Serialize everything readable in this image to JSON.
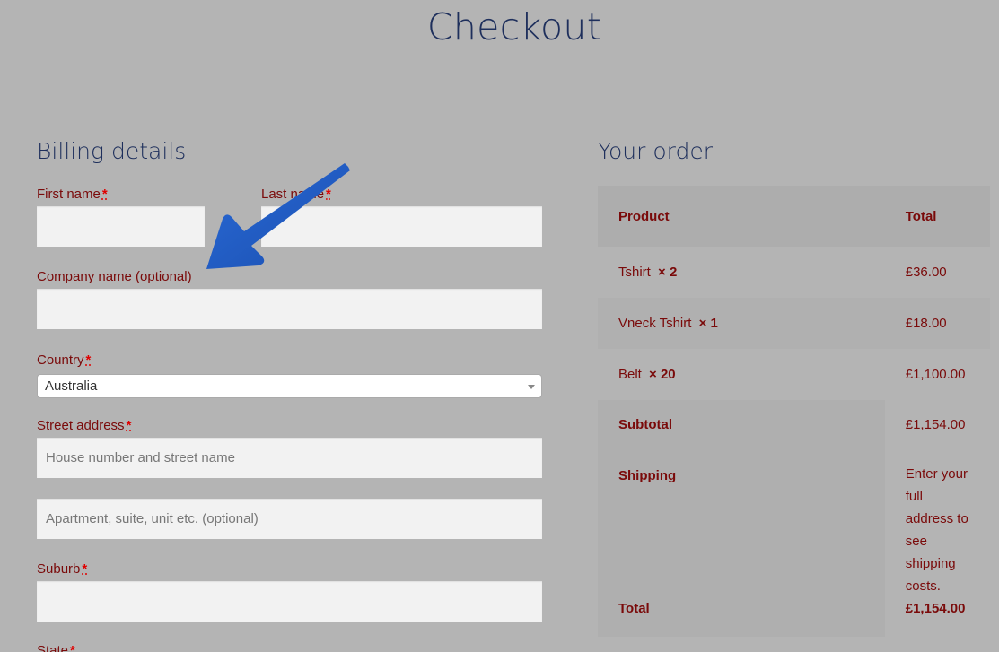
{
  "page": {
    "title": "Checkout"
  },
  "billing": {
    "title": "Billing details",
    "required_marker": "*",
    "fields": {
      "first_name": {
        "label": "First name",
        "value": ""
      },
      "last_name": {
        "label": "Last name",
        "value": ""
      },
      "company": {
        "label": "Company name (optional)",
        "value": ""
      },
      "country": {
        "label": "Country",
        "value": "Australia"
      },
      "street": {
        "label": "Street address",
        "placeholder": "House number and street name",
        "value": ""
      },
      "street2": {
        "placeholder": "Apartment, suite, unit etc. (optional)",
        "value": ""
      },
      "suburb": {
        "label": "Suburb",
        "value": ""
      },
      "state": {
        "label": "State"
      }
    }
  },
  "order": {
    "title": "Your order",
    "headers": {
      "product": "Product",
      "total": "Total"
    },
    "items": [
      {
        "name": "Tshirt",
        "qty": "× 2",
        "total": "£36.00"
      },
      {
        "name": "Vneck Tshirt",
        "qty": "× 1",
        "total": "£18.00"
      },
      {
        "name": "Belt",
        "qty": "× 20",
        "total": "£1,100.00"
      }
    ],
    "subtotal": {
      "label": "Subtotal",
      "value": "£1,154.00"
    },
    "shipping": {
      "label": "Shipping",
      "value": "Enter your full address to see shipping costs."
    },
    "total": {
      "label": "Total",
      "value": "£1,154.00"
    }
  },
  "annotation": {
    "arrow_color": "#1f5bc4",
    "points_to": "Company name (optional)"
  }
}
